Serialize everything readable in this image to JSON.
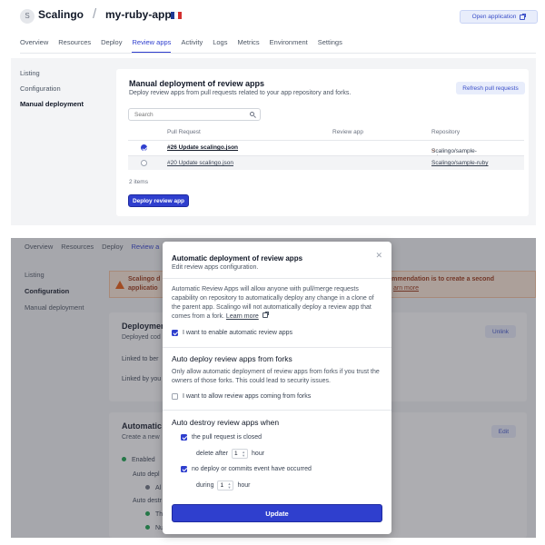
{
  "header": {
    "avatar_letter": "S",
    "org_name": "Scalingo",
    "separator": "/",
    "app_name": "my-ruby-app",
    "open_app_label": "Open application"
  },
  "nav": {
    "tabs": [
      "Overview",
      "Resources",
      "Deploy",
      "Review apps",
      "Activity",
      "Logs",
      "Metrics",
      "Environment",
      "Settings"
    ],
    "active": "Review apps"
  },
  "top": {
    "sidebar": [
      "Listing",
      "Configuration",
      "Manual deployment"
    ],
    "card": {
      "title": "Manual deployment of review apps",
      "subtitle": "Deploy review apps from pull requests related to your app repository and forks.",
      "refresh_label": "Refresh pull requests",
      "search_placeholder": "Search",
      "columns": [
        "Pull Request",
        "Review app",
        "Repository"
      ],
      "rows": [
        {
          "selected": true,
          "pull_request": "#26 Update scalingo.json",
          "review_app": "",
          "repository": "Scalingo/sample-ruby",
          "fork": true
        },
        {
          "selected": false,
          "pull_request": "#20 Update scalingo.json",
          "review_app": "",
          "repository": "Scalingo/sample-ruby",
          "fork": false
        }
      ],
      "items_count": "2 items",
      "deploy_label": "Deploy review app"
    }
  },
  "bottom": {
    "nav_tabs": [
      "Overview",
      "Resources",
      "Deploy",
      "Review a"
    ],
    "sidebar": [
      "Listing",
      "Configuration",
      "Manual deployment"
    ],
    "warning": {
      "line1": "Scalingo d",
      "line2": "applicatio",
      "line3": "commendation is to create a second",
      "link": "arn more"
    },
    "card1": {
      "title": "Deployment",
      "subtitle": "Deployed cod",
      "linked_to": "Linked to ber",
      "linked_by": "Linked by you",
      "unlink_label": "Unlink"
    },
    "card2": {
      "title": "Automatic d",
      "subtitle": "Create a new",
      "enabled": "Enabled",
      "auto_deploy": "Auto depl",
      "auto_deploy_item": "Al",
      "auto_destroy": "Auto destr",
      "destroy_item1": "Th",
      "destroy_item2": "Nu",
      "edit_label": "Edit"
    }
  },
  "modal": {
    "title": "Automatic deployment of review apps",
    "subtitle": "Edit review apps configuration.",
    "description": "Automatic Review Apps will allow anyone with pull/merge requests capability on repository to automatically deploy any change in a clone of the parent app. Scalingo will not automatically deploy a review app that comes from a fork.",
    "learn_more": "Learn more",
    "enable_label": "I want to enable automatic review apps",
    "enable_checked": true,
    "forks_heading": "Auto deploy review apps from forks",
    "forks_description": "Only allow automatic deployment of review apps from forks if you trust the owners of those forks. This could lead to security issues.",
    "forks_label": "I want to allow review apps coming from forks",
    "forks_checked": false,
    "destroy_heading": "Auto destroy review apps when",
    "closed_label": "the pull request is closed",
    "closed_checked": true,
    "delete_after_label": "delete after",
    "delete_after_value": "1",
    "delete_after_unit": "hour",
    "no_deploy_label": "no deploy or commits event have occurred",
    "no_deploy_checked": true,
    "during_label": "during",
    "during_value": "1",
    "during_unit": "hour",
    "update_label": "Update"
  },
  "colors": {
    "accent": "#2f3fce",
    "accent_light": "#e8edfb",
    "warning_bg": "#fde8d8",
    "fork_icon": "#ea580c",
    "flag": [
      "#1f3a93",
      "#ffffff",
      "#d32f2f"
    ]
  }
}
